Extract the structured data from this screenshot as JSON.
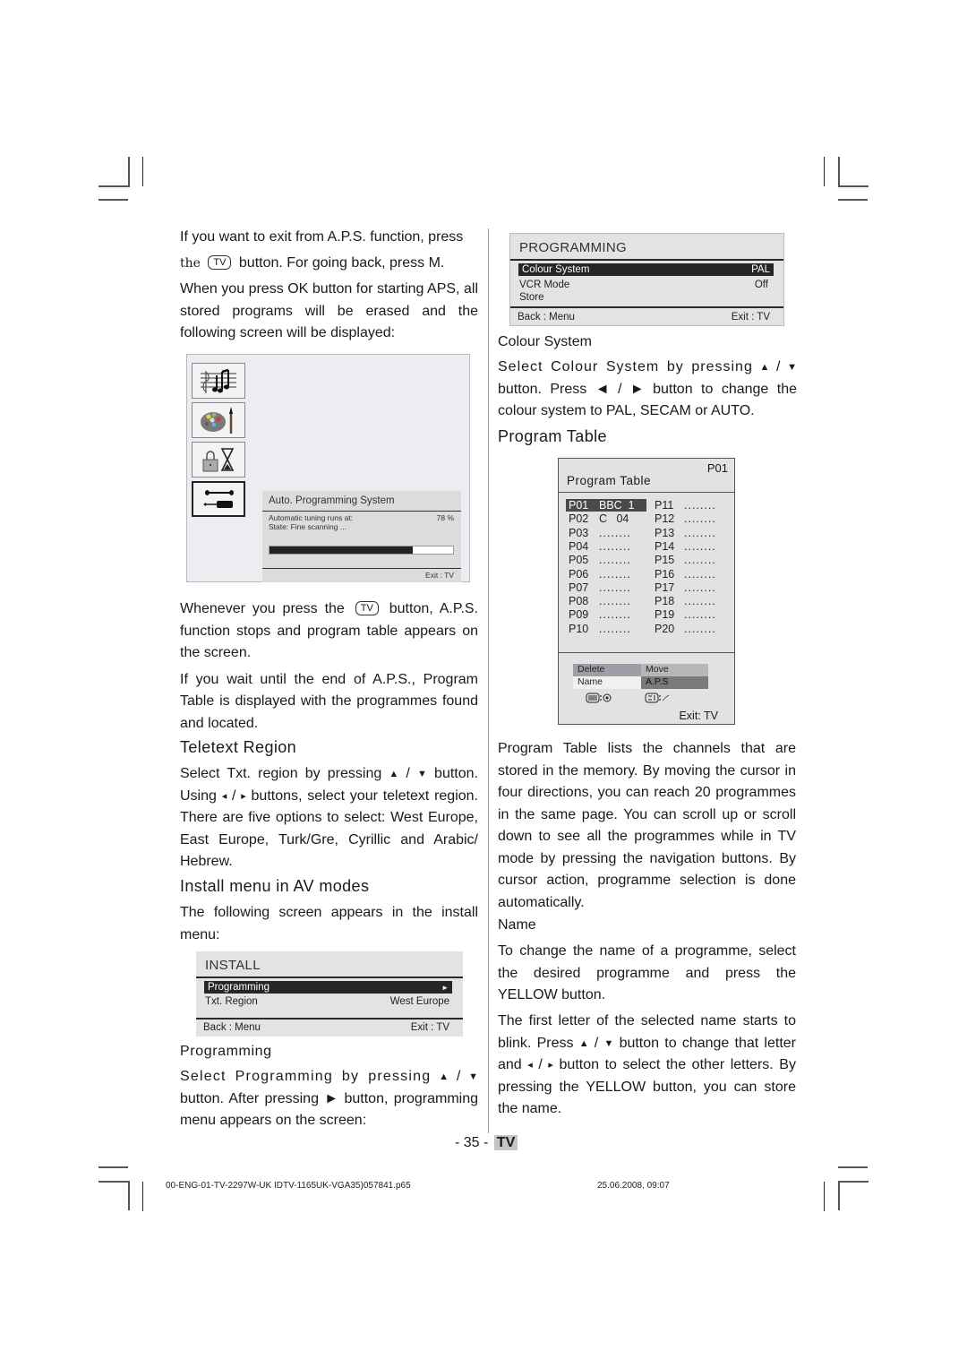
{
  "left_column": {
    "intro_p1": "If you want to exit from A.P.S. function, press",
    "intro_p1b_prefix": "the",
    "intro_p1b_suffix": "button. For going back, press M.",
    "intro_p2": "When you press OK button for starting  APS, all stored programs will be erased and the following  screen will be displayed:",
    "tv_key_label": "TV",
    "aps_screen": {
      "icons": [
        "music-icon",
        "palette-icon",
        "lock-timer-icon",
        "tools-icon"
      ],
      "panel_title": "Auto. Programming System",
      "status_label": "Automatic tuning runs at:",
      "status_value": "78 %",
      "progress_percent": 78,
      "state_text": "State: Fine scanning ...",
      "footer": "Exit : TV"
    },
    "after_p1_prefix": "Whenever you press the",
    "after_p1_suffix": "button,  A.P.S. function stops and program table appears on the screen.",
    "after_p2": "If you wait until the end of A.P.S., Program Table is displayed with the programmes found and located.",
    "teletext_heading": "Teletext  Region",
    "teletext_p_a": "Select Txt. region by pressing",
    "teletext_p_b": "button. Using",
    "teletext_p_c": "buttons, select your teletext region. There are five options to select: West Europe, East Europe, Turk/Gre, Cyrillic and Arabic/ Hebrew.",
    "install_heading": "Install menu in AV modes",
    "install_p": "The following screen appears in the install menu:",
    "install_menu": {
      "title": "INSTALL",
      "items": [
        {
          "label": "Programming",
          "value": "►",
          "selected": true
        },
        {
          "label": "Txt. Region",
          "value": "West Europe",
          "selected": false
        }
      ],
      "footer_left": "Back : Menu",
      "footer_right": "Exit : TV"
    },
    "programming_sub": "Programming",
    "programming_p_a": "Select Programming by pressing",
    "programming_p_b": "button. After pressing ► button, programming menu appears on the screen:"
  },
  "right_column": {
    "programming_menu": {
      "title": "PROGRAMMING",
      "items": [
        {
          "label": "Colour System",
          "value": "PAL",
          "selected": true
        },
        {
          "label": "VCR Mode",
          "value": "Off",
          "selected": false
        },
        {
          "label": "Store",
          "value": "",
          "selected": false
        }
      ],
      "footer_left": "Back : Menu",
      "footer_right": "Exit : TV"
    },
    "colour_sub": "Colour System",
    "colour_p_a": "Select Colour System by pressing",
    "colour_p_b": "button. Press ◄ / ► button to change the colour system to PAL, SECAM or AUTO.",
    "program_table_heading": "Program  Table",
    "program_table": {
      "current": "P01",
      "title": "Program Table",
      "left": [
        {
          "num": "P01",
          "name": "BBC  1",
          "selected": true
        },
        {
          "num": "P02",
          "name": "C   04"
        },
        {
          "num": "P03",
          "name": "........"
        },
        {
          "num": "P04",
          "name": "........"
        },
        {
          "num": "P05",
          "name": "........"
        },
        {
          "num": "P06",
          "name": "........"
        },
        {
          "num": "P07",
          "name": "........"
        },
        {
          "num": "P08",
          "name": "........"
        },
        {
          "num": "P09",
          "name": "........"
        },
        {
          "num": "P10",
          "name": "........"
        }
      ],
      "right": [
        {
          "num": "P11",
          "name": "........"
        },
        {
          "num": "P12",
          "name": "........"
        },
        {
          "num": "P13",
          "name": "........"
        },
        {
          "num": "P14",
          "name": "........"
        },
        {
          "num": "P15",
          "name": "........"
        },
        {
          "num": "P16",
          "name": "........"
        },
        {
          "num": "P17",
          "name": "........"
        },
        {
          "num": "P18",
          "name": "........"
        },
        {
          "num": "P19",
          "name": "........"
        },
        {
          "num": "P20",
          "name": "........"
        }
      ],
      "options": {
        "delete": "Delete",
        "move": "Move",
        "name": "Name",
        "aps": "A.P.S"
      },
      "key_hints": [
        "teletext-key-icon",
        "index-key-icon"
      ],
      "footer": "Exit: TV"
    },
    "pt_p": "Program Table lists the channels that are stored in the memory. By moving the cursor in four directions, you can reach 20 programmes in the same page. You can scroll up or scroll down to see all the programmes while in TV mode by pressing the navigation buttons. By cursor action, programme selection is done automatically.",
    "name_sub": "Name",
    "name_p1": "To change the name of a programme, select the desired programme and press the YELLOW button.",
    "name_p2_a": "The first letter of the selected name starts to blink. Press",
    "name_p2_b": "button to change that letter and",
    "name_p2_c": "button to select the other letters.  By pressing the YELLOW button, you can store the name."
  },
  "page_footer": {
    "page_number": "- 35 -",
    "section_tag": "TV",
    "file_name": "00-ENG-01-TV-2297W-UK IDTV-1165UK-VGA35)057841.p65",
    "timestamp": "25.06.2008, 09:07"
  },
  "symbols": {
    "up": "▲",
    "down": "▼",
    "left": "◄",
    "right": "►",
    "slash": " / ",
    "small_left": "◂",
    "small_right": "▸"
  }
}
